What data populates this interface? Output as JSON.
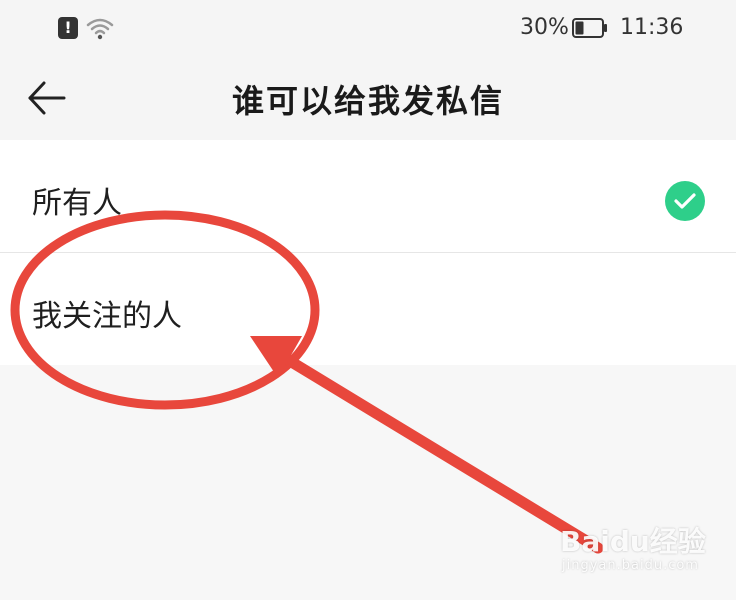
{
  "status_bar": {
    "battery_percent": "30%",
    "time": "11:36",
    "battery_level": 0.3,
    "icons": [
      "alert-icon",
      "wifi-icon",
      "battery-icon"
    ]
  },
  "header": {
    "back_icon": "arrow-left-icon",
    "title": "谁可以给我发私信"
  },
  "options": [
    {
      "label": "所有人",
      "selected": true
    },
    {
      "label": "我关注的人",
      "selected": false
    }
  ],
  "colors": {
    "check_green": "#2ecf8a",
    "annotation_red": "#e8473c",
    "background": "#f7f7f7"
  },
  "watermark": {
    "brand": "Baidu经验",
    "url": "jingyan.baidu.com"
  }
}
